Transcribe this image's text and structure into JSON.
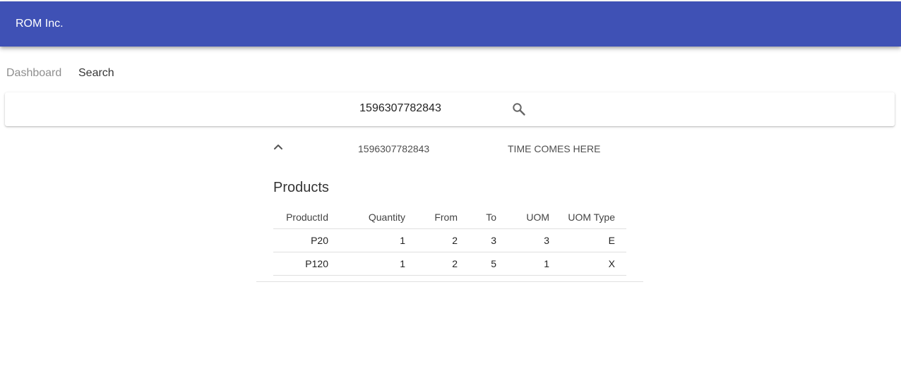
{
  "app": {
    "title": "ROM Inc.",
    "primary_color": "#3f51b5"
  },
  "nav": {
    "dashboard_label": "Dashboard",
    "search_label": "Search"
  },
  "search": {
    "value": "1596307782843",
    "icon": "search-icon"
  },
  "result": {
    "expand_icon": "chevron-up-icon",
    "id": "1596307782843",
    "time": "TIME COMES HERE",
    "products_title": "Products",
    "columns": [
      "ProductId",
      "Quantity",
      "From",
      "To",
      "UOM",
      "UOM Type"
    ],
    "rows": [
      [
        "P20",
        "1",
        "2",
        "3",
        "3",
        "E"
      ],
      [
        "P120",
        "1",
        "2",
        "5",
        "1",
        "X"
      ]
    ]
  }
}
